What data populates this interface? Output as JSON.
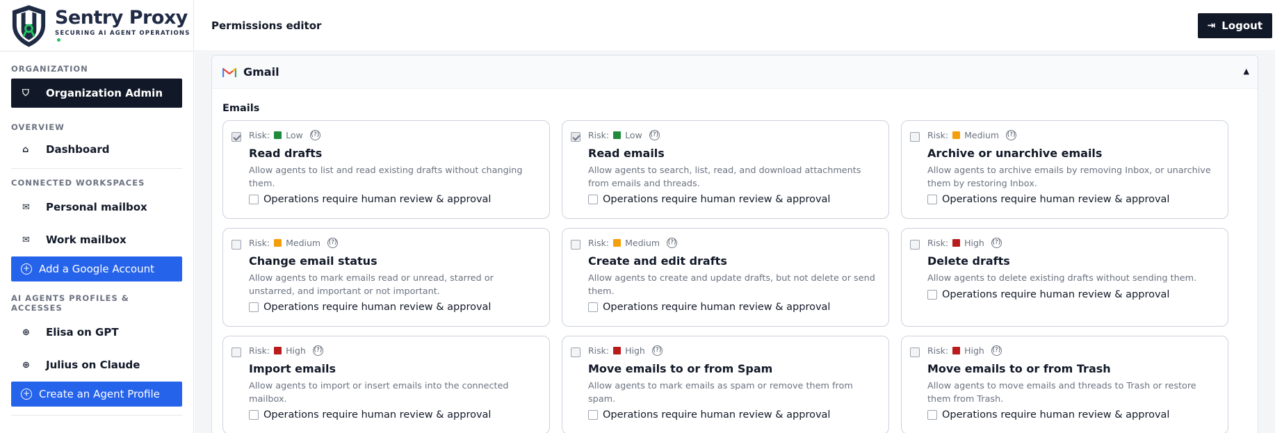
{
  "brand": {
    "name": "Sentry Proxy",
    "tagline": "SECURING AI AGENT OPERATIONS"
  },
  "sidebar": {
    "org_label": "ORGANIZATION",
    "org_item": "Organization Admin",
    "overview_label": "OVERVIEW",
    "dashboard": "Dashboard",
    "workspaces_label": "CONNECTED WORKSPACES",
    "workspaces": [
      "Personal mailbox",
      "Work mailbox"
    ],
    "add_google": "Add a Google Account",
    "agents_label": "AI AGENTS PROFILES & ACCESSES",
    "agents": [
      "Elisa on GPT",
      "Julius on Claude"
    ],
    "create_agent": "Create an Agent Profile"
  },
  "header": {
    "title": "Permissions editor",
    "logout": "Logout"
  },
  "panel": {
    "title": "Gmail",
    "group": "Emails"
  },
  "risk_prefix": "Risk:",
  "help": "(?)",
  "review_label": "Operations require human review & approval",
  "risk_colors": {
    "Low": "#1f8a3b",
    "Medium": "#f59e0b",
    "High": "#b91c1c"
  },
  "permissions": [
    {
      "title": "Read drafts",
      "risk": "Low",
      "checked": true,
      "desc": "Allow agents to list and read existing drafts without changing them."
    },
    {
      "title": "Read emails",
      "risk": "Low",
      "checked": true,
      "desc": "Allow agents to search, list, read, and download attachments from emails and threads."
    },
    {
      "title": "Archive or unarchive emails",
      "risk": "Medium",
      "checked": false,
      "desc": "Allow agents to archive emails by removing Inbox, or unarchive them by restoring Inbox."
    },
    {
      "title": "Change email status",
      "risk": "Medium",
      "checked": false,
      "desc": "Allow agents to mark emails read or unread, starred or unstarred, and important or not important."
    },
    {
      "title": "Create and edit drafts",
      "risk": "Medium",
      "checked": false,
      "desc": "Allow agents to create and update drafts, but not delete or send them."
    },
    {
      "title": "Delete drafts",
      "risk": "High",
      "checked": false,
      "desc": "Allow agents to delete existing drafts without sending them."
    },
    {
      "title": "Import emails",
      "risk": "High",
      "checked": false,
      "desc": "Allow agents to import or insert emails into the connected mailbox."
    },
    {
      "title": "Move emails to or from Spam",
      "risk": "High",
      "checked": false,
      "desc": "Allow agents to mark emails as spam or remove them from spam."
    },
    {
      "title": "Move emails to or from Trash",
      "risk": "High",
      "checked": false,
      "desc": "Allow agents to move emails and threads to Trash or restore them from Trash."
    }
  ]
}
